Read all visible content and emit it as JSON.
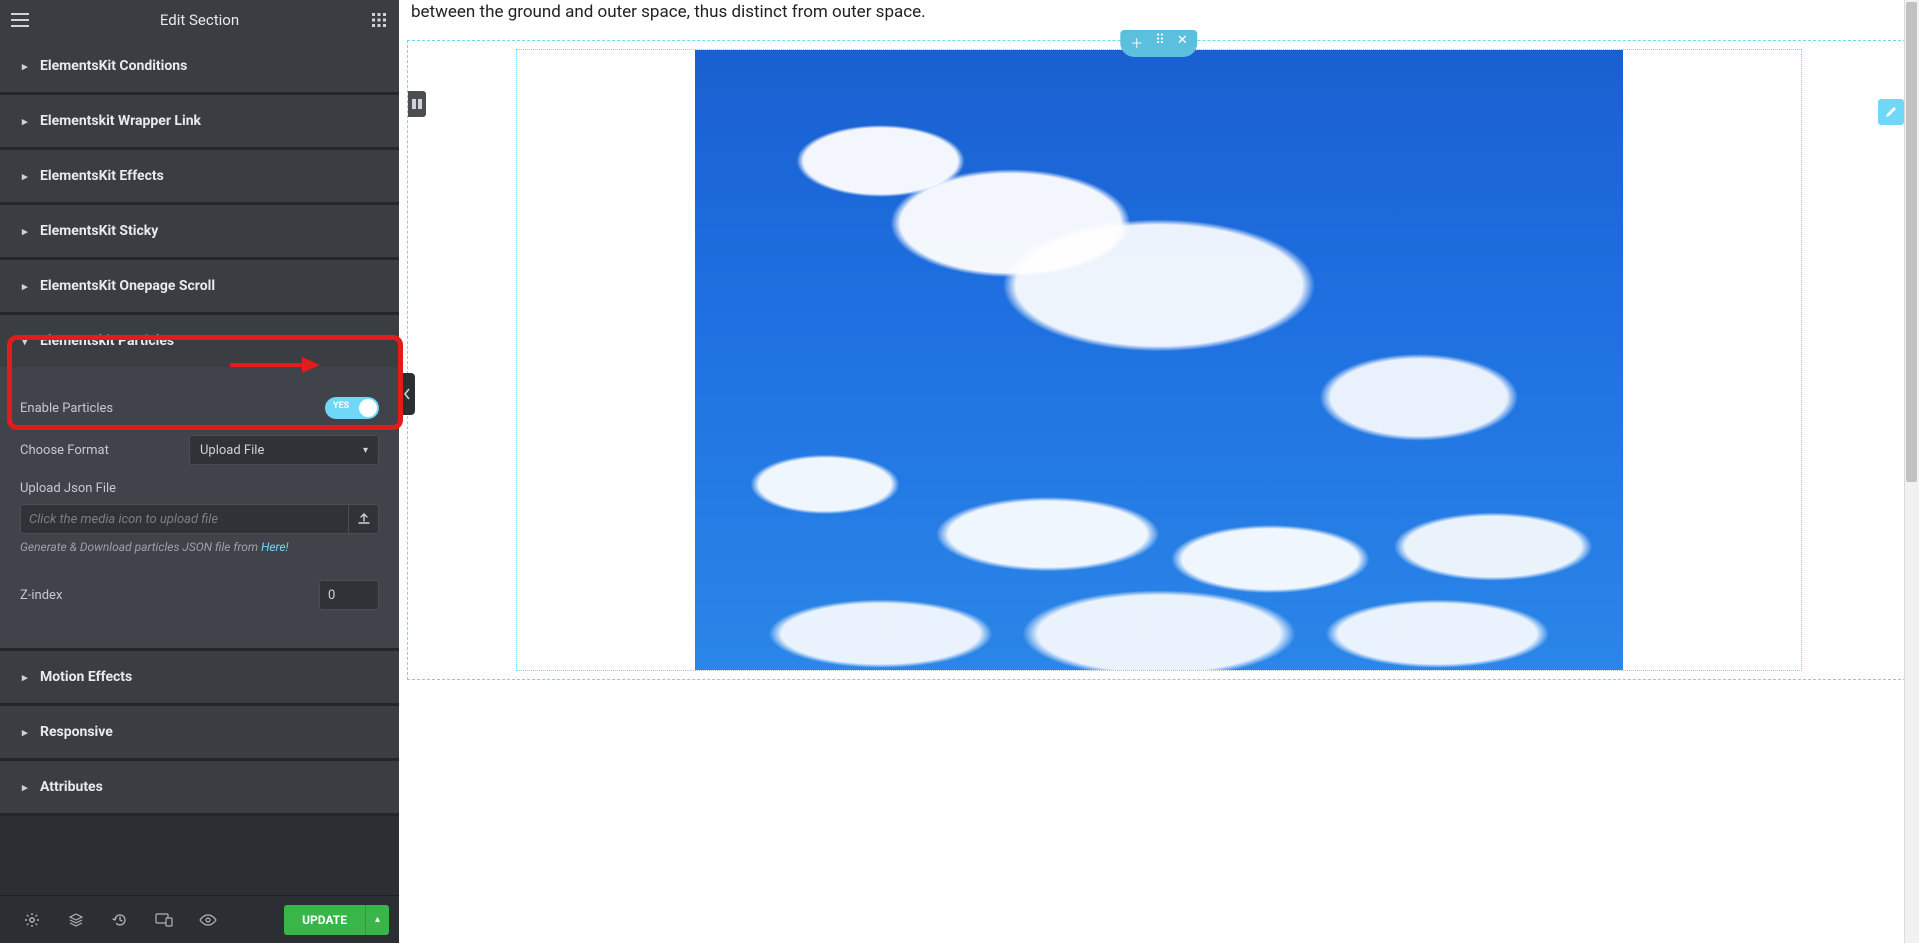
{
  "header": {
    "title": "Edit Section"
  },
  "accordions": {
    "conditions": "ElementsKit Conditions",
    "wrapper_link": "Elementskit Wrapper Link",
    "effects": "ElementsKit Effects",
    "sticky": "ElementsKit Sticky",
    "onepage": "ElementsKit Onepage Scroll",
    "particles": "Elementskit Particles",
    "motion": "Motion Effects",
    "responsive": "Responsive",
    "attributes": "Attributes"
  },
  "particles": {
    "enable_label": "Enable Particles",
    "toggle_text": "YES",
    "choose_format_label": "Choose Format",
    "choose_format_value": "Upload File",
    "upload_label": "Upload Json File",
    "upload_placeholder": "Click the media icon to upload file",
    "hint_prefix": "Generate & Download particles JSON file from ",
    "hint_link": "Here!",
    "zindex_label": "Z-index",
    "zindex_value": "0"
  },
  "footer": {
    "update": "UPDATE"
  },
  "preview": {
    "top_text": "between the ground and outer space, thus distinct from outer space."
  }
}
